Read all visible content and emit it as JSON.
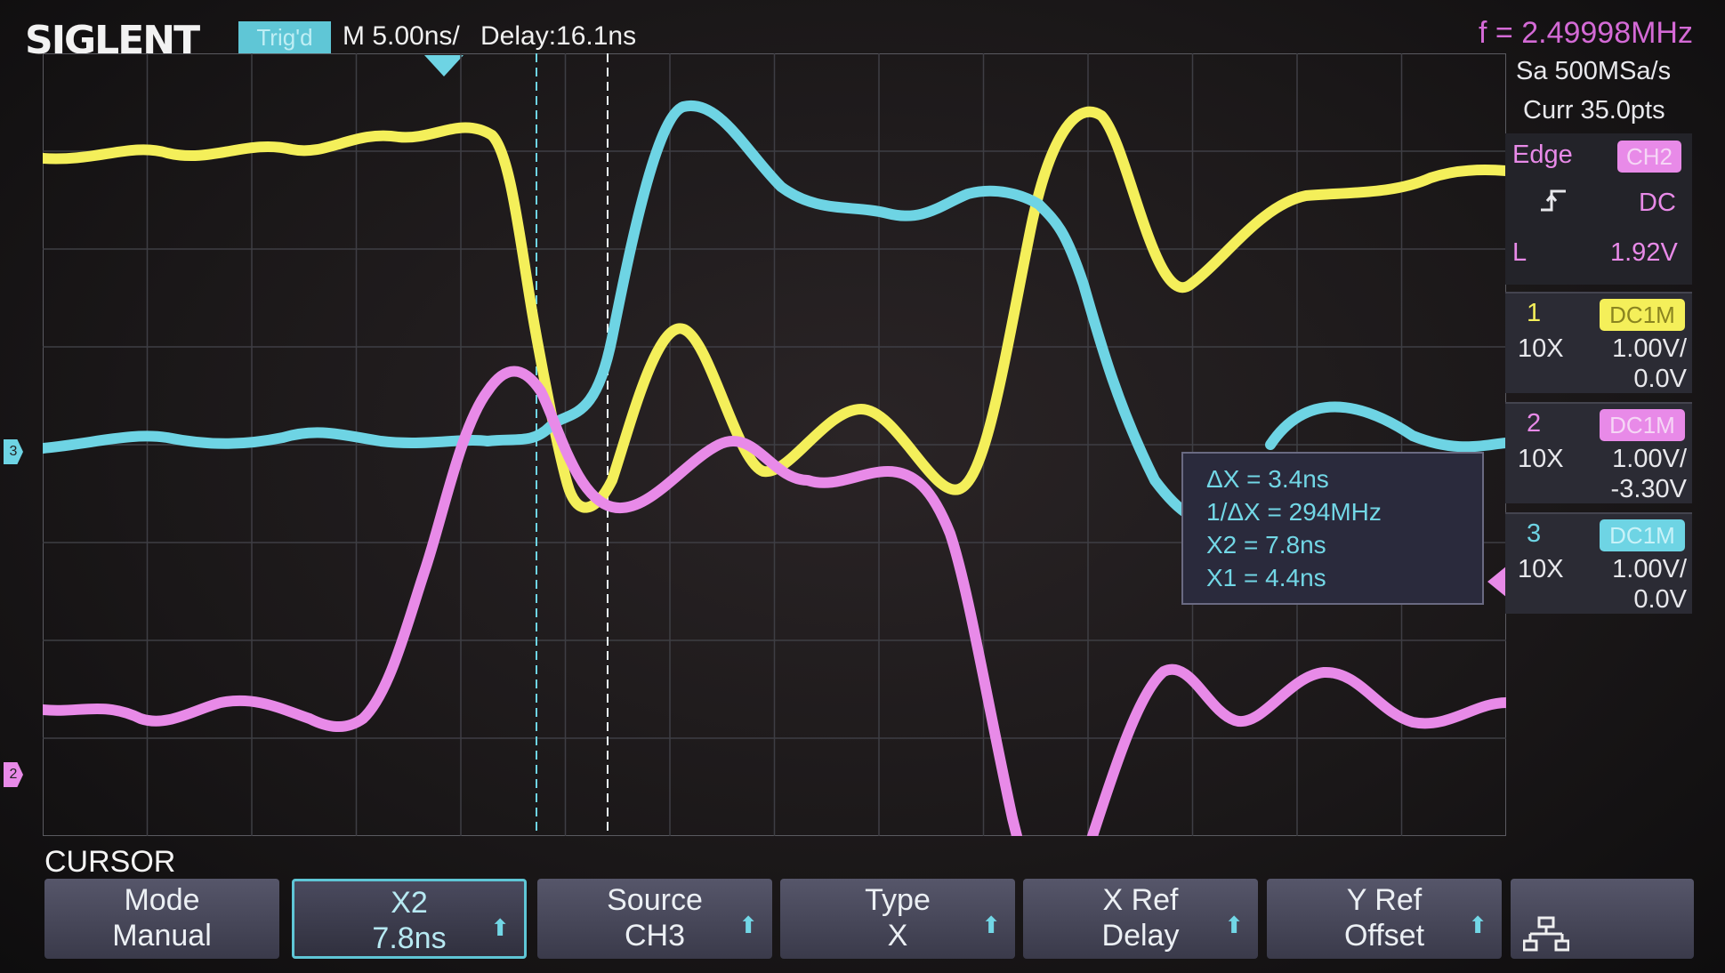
{
  "header": {
    "brand": "SIGLENT",
    "trigger_status": "Trig'd",
    "timebase": "M 5.00ns/",
    "delay": "Delay:16.1ns",
    "frequency": "f = 2.49998MHz"
  },
  "acquisition": {
    "sample_rate": "Sa 500MSa/s",
    "memory": "Curr 35.0pts"
  },
  "trigger": {
    "type": "Edge",
    "source": "CH2",
    "slope_icon": "rising-edge-icon",
    "coupling": "DC",
    "level_label": "L",
    "level": "1.92V"
  },
  "channels": [
    {
      "num": "1",
      "coupling": "DC1M",
      "probe": "10X",
      "scale": "1.00V/",
      "offset": "0.0V",
      "color": "#f4ef5a"
    },
    {
      "num": "2",
      "coupling": "DC1M",
      "probe": "10X",
      "scale": "1.00V/",
      "offset": "-3.30V",
      "color": "#e88ae8"
    },
    {
      "num": "3",
      "coupling": "DC1M",
      "probe": "10X",
      "scale": "1.00V/",
      "offset": "0.0V",
      "color": "#6ed4e4"
    }
  ],
  "channel_markers": {
    "ch3": "3",
    "ch2": "2"
  },
  "cursor_readout": {
    "delta_x": "ΔX = 3.4ns",
    "inv_delta_x": "1/ΔX = 294MHz",
    "x2": "X2 = 7.8ns",
    "x1": "X1 = 4.4ns"
  },
  "menu": {
    "title": "CURSOR",
    "buttons": [
      {
        "line1": "Mode",
        "line2": "Manual",
        "arrow": false,
        "active": false
      },
      {
        "line1": "X2",
        "line2": "7.8ns",
        "arrow": true,
        "active": true
      },
      {
        "line1": "Source",
        "line2": "CH3",
        "arrow": true,
        "active": false
      },
      {
        "line1": "Type",
        "line2": "X",
        "arrow": true,
        "active": false
      },
      {
        "line1": "X Ref",
        "line2": "Delay",
        "arrow": true,
        "active": false
      },
      {
        "line1": "Y Ref",
        "line2": "Offset",
        "arrow": true,
        "active": false
      }
    ],
    "network_icon": "network-icon"
  },
  "colors": {
    "ch1": "#f4ef5a",
    "ch2": "#e88ae8",
    "ch3": "#6ed4e4",
    "trig_status_bg": "#5fc6d6"
  }
}
